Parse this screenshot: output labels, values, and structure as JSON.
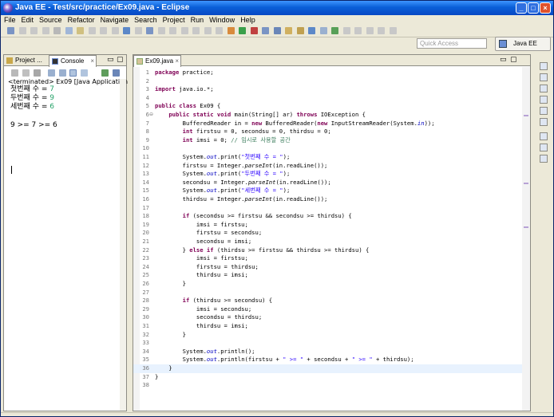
{
  "window": {
    "title": "Java EE - Test/src/practice/Ex09.java - Eclipse",
    "min": "_",
    "max": "□",
    "close": "×"
  },
  "menu": [
    "File",
    "Edit",
    "Source",
    "Refactor",
    "Navigate",
    "Search",
    "Project",
    "Run",
    "Window",
    "Help"
  ],
  "toolbar": {
    "quick_access_placeholder": "Quick Access",
    "perspective": "Java EE"
  },
  "left_tabs": {
    "project": "Project ...",
    "console": "Console"
  },
  "console": {
    "terminated": "<terminated> Ex09 [Java Application] C",
    "lines": [
      {
        "prompt": "첫번째 수 = ",
        "input": "7"
      },
      {
        "prompt": "두번째 수 = ",
        "input": "9"
      },
      {
        "prompt": "세번째 수 = ",
        "input": "6"
      }
    ],
    "result": "9 >= 7 >= 6"
  },
  "editor_tab": "Ex09.java",
  "code": [
    "package practice;",
    "",
    "import java.io.*;",
    "",
    "public class Ex09 {",
    "    public static void main(String[] ar) throws IOException {",
    "        BufferedReader in = new BufferedReader(new InputStreamReader(System.in));",
    "        int firstsu = 0, secondsu = 0, thirdsu = 0;",
    "        int imsi = 0; // 임시로 사용할 공간",
    "",
    "        System.out.print(\"첫번째 수 = \");",
    "        firstsu = Integer.parseInt(in.readLine());",
    "        System.out.print(\"두번째 수 = \");",
    "        secondsu = Integer.parseInt(in.readLine());",
    "        System.out.print(\"세번째 수 = \");",
    "        thirdsu = Integer.parseInt(in.readLine());",
    "",
    "        if (secondsu >= firstsu && secondsu >= thirdsu) {",
    "            imsi = firstsu;",
    "            firstsu = secondsu;",
    "            secondsu = imsi;",
    "        } else if (thirdsu >= firstsu && thirdsu >= thirdsu) {",
    "            imsi = firstsu;",
    "            firstsu = thirdsu;",
    "            thirdsu = imsi;",
    "        }",
    "",
    "        if (thirdsu >= secondsu) {",
    "            imsi = secondsu;",
    "            secondsu = thirdsu;",
    "            thirdsu = imsi;",
    "        }",
    "",
    "        System.out.println();",
    "        System.out.println(firstsu + \" >= \" + secondsu + \" >= \" + thirdsu);",
    "    }",
    "}",
    ""
  ],
  "current_line": 36,
  "colors": {
    "keyword": "#7f0055",
    "string": "#2a00ff",
    "comment": "#3f7f5f",
    "field": "#0000c0",
    "console_input": "#26a269",
    "titlebar": "#0a5fd8"
  }
}
